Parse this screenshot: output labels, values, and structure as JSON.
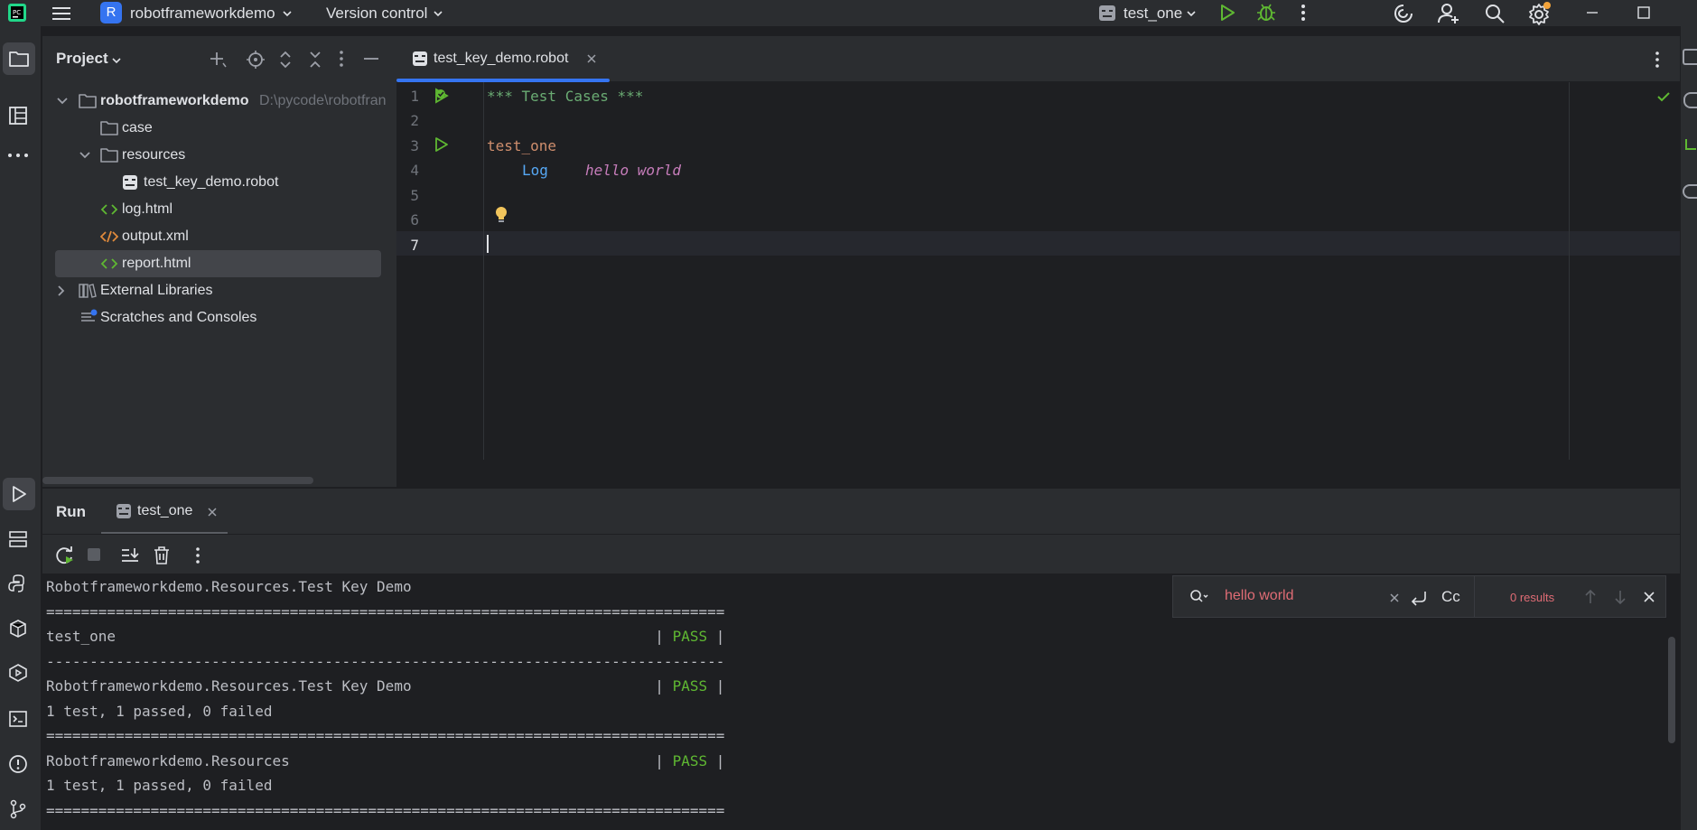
{
  "titlebar": {
    "project_letter": "R",
    "project_name": "robotframeworkdemo",
    "vcs_label": "Version control",
    "run_config": "test_one"
  },
  "project_panel": {
    "title": "Project",
    "tree": [
      {
        "label": "robotframeworkdemo",
        "path": "D:\\pycode\\robotfran"
      },
      {
        "label": "case"
      },
      {
        "label": "resources"
      },
      {
        "label": "test_key_demo.robot"
      },
      {
        "label": "log.html"
      },
      {
        "label": "output.xml"
      },
      {
        "label": "report.html"
      },
      {
        "label": "External Libraries"
      },
      {
        "label": "Scratches and Consoles"
      }
    ]
  },
  "editor": {
    "tab_label": "test_key_demo.robot",
    "line_numbers": [
      "1",
      "2",
      "3",
      "4",
      "5",
      "6",
      "7"
    ],
    "code": {
      "header": "*** Test Cases ***",
      "test_name": "test_one",
      "keyword": "Log",
      "argument": "hello world"
    }
  },
  "run_panel": {
    "title": "Run",
    "tab_label": "test_one",
    "console_lines": [
      {
        "text": "Robotframeworkdemo.Resources.Test Key Demo"
      },
      {
        "text": "=============================================================================="
      },
      {
        "text": "test_one                                                              | ",
        "status": "PASS",
        "end": " |"
      },
      {
        "text": "------------------------------------------------------------------------------"
      },
      {
        "text": "Robotframeworkdemo.Resources.Test Key Demo                            | ",
        "status": "PASS",
        "end": " |"
      },
      {
        "text": "1 test, 1 passed, 0 failed"
      },
      {
        "text": "=============================================================================="
      },
      {
        "text": "Robotframeworkdemo.Resources                                          | ",
        "status": "PASS",
        "end": " |"
      },
      {
        "text": "1 test, 1 passed, 0 failed"
      },
      {
        "text": "=============================================================================="
      }
    ]
  },
  "search": {
    "query": "hello world",
    "match_case_label": "Cc",
    "results": "0 results"
  },
  "colors": {
    "accent": "#3574f0",
    "pass": "#5fb832",
    "header_green": "#6aab73",
    "keyword_blue": "#56a8f5",
    "argument_pink": "#c77dbb",
    "test_name_orange": "#cf8e6d",
    "search_text": "#e06c75"
  }
}
